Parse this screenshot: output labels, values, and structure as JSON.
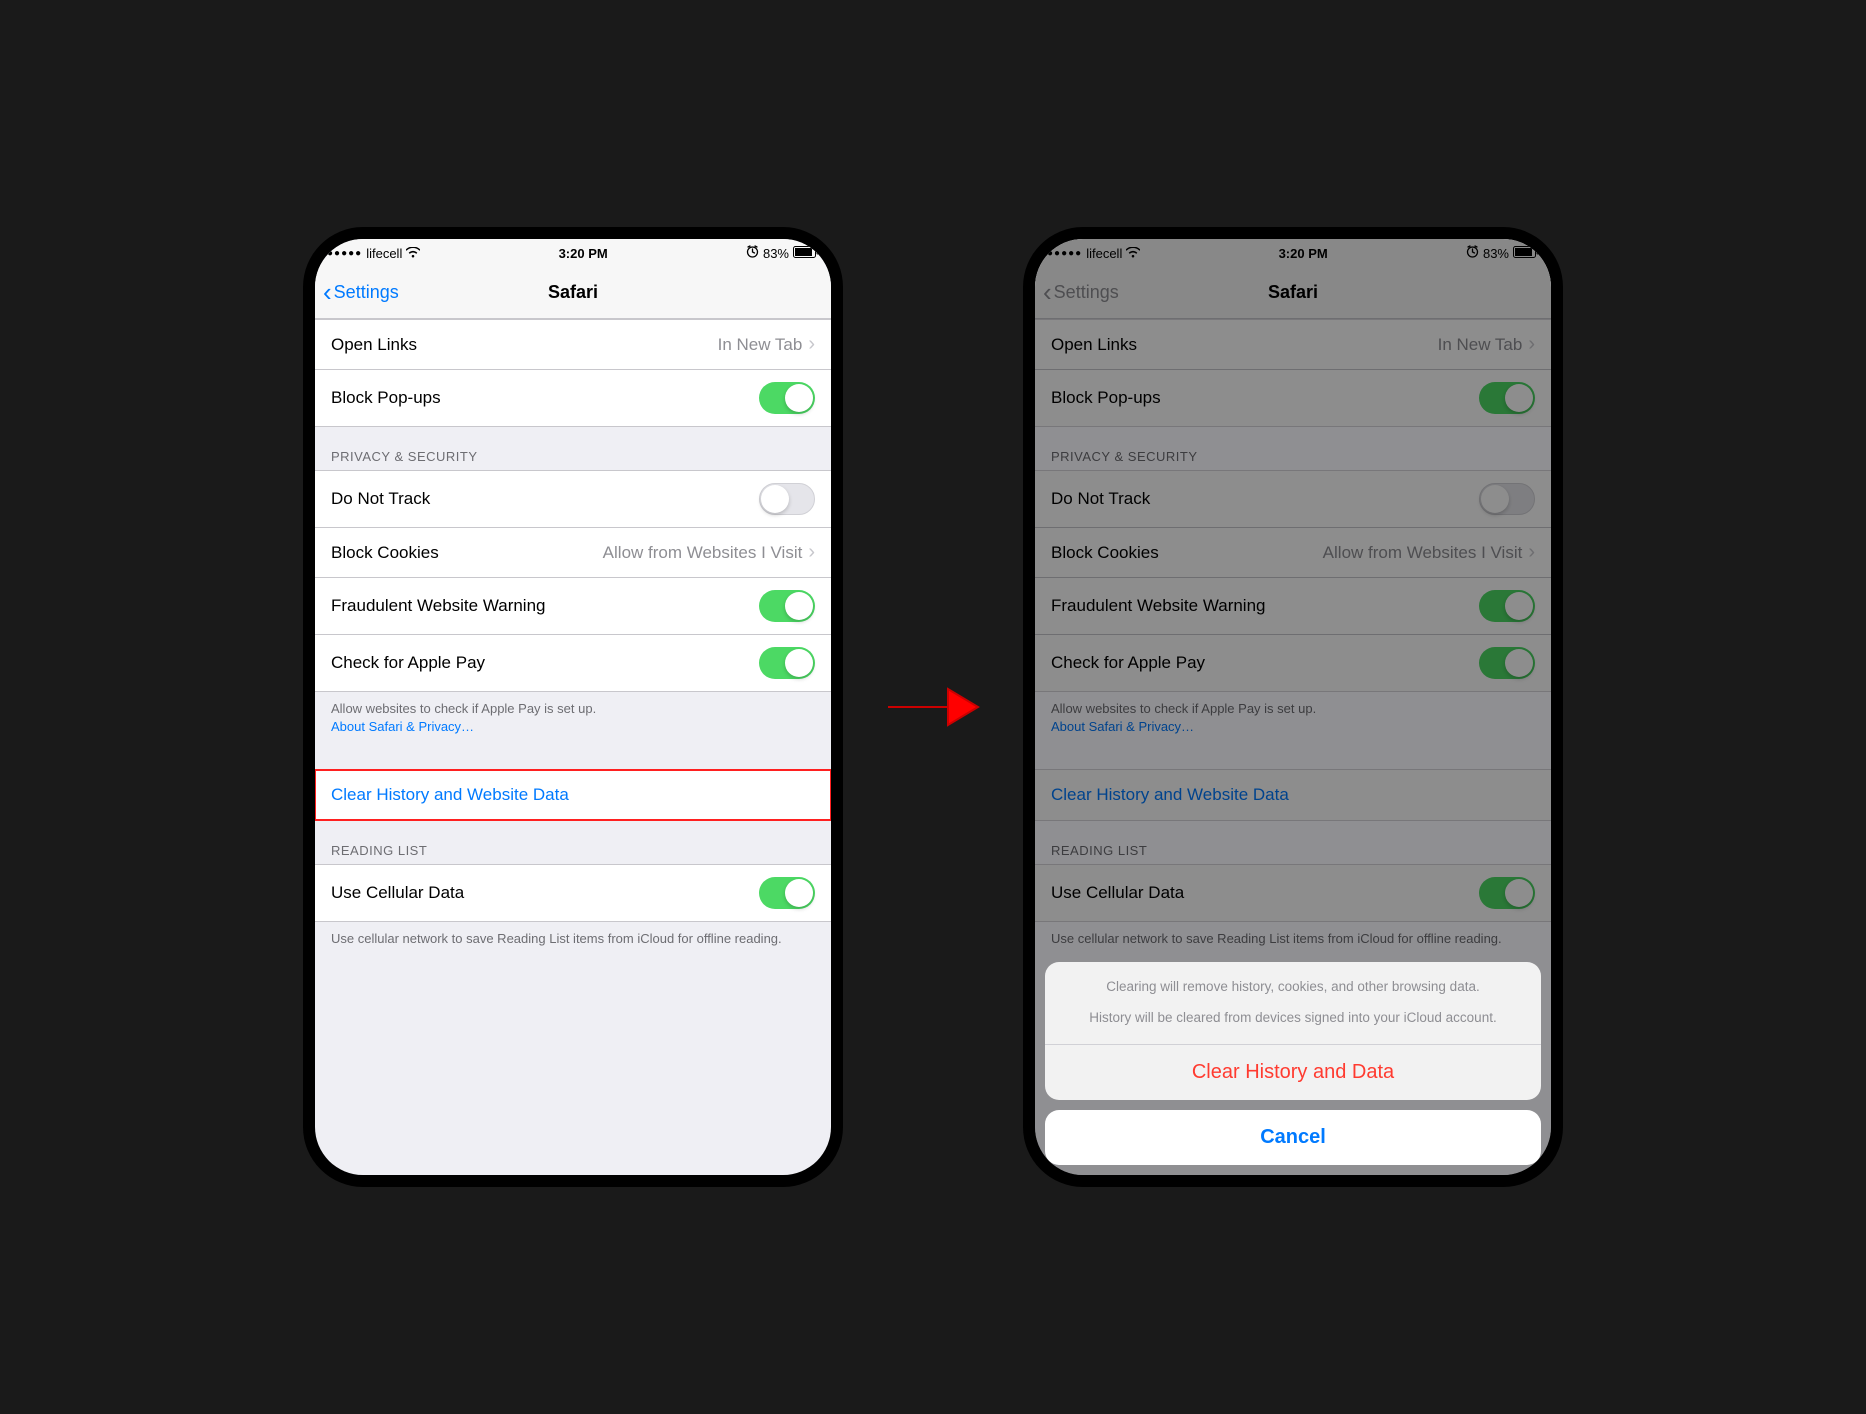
{
  "status": {
    "carrier": "lifecell",
    "time": "3:20 PM",
    "battery_pct": "83%"
  },
  "nav": {
    "back_label": "Settings",
    "title": "Safari"
  },
  "general": {
    "open_links_label": "Open Links",
    "open_links_value": "In New Tab",
    "block_popups_label": "Block Pop-ups"
  },
  "privacy": {
    "header": "PRIVACY & SECURITY",
    "dnt_label": "Do Not Track",
    "block_cookies_label": "Block Cookies",
    "block_cookies_value": "Allow from Websites I Visit",
    "fraud_label": "Fraudulent Website Warning",
    "apple_pay_label": "Check for Apple Pay",
    "footer_text": "Allow websites to check if Apple Pay is set up.",
    "footer_link": "About Safari & Privacy…"
  },
  "clear": {
    "label": "Clear History and Website Data"
  },
  "reading": {
    "header": "READING LIST",
    "cellular_label": "Use Cellular Data",
    "footer": "Use cellular network to save Reading List items from iCloud for offline reading."
  },
  "sheet": {
    "msg1": "Clearing will remove history, cookies, and other browsing data.",
    "msg2": "History will be cleared from devices signed into your iCloud account.",
    "action": "Clear History and Data",
    "cancel": "Cancel"
  }
}
